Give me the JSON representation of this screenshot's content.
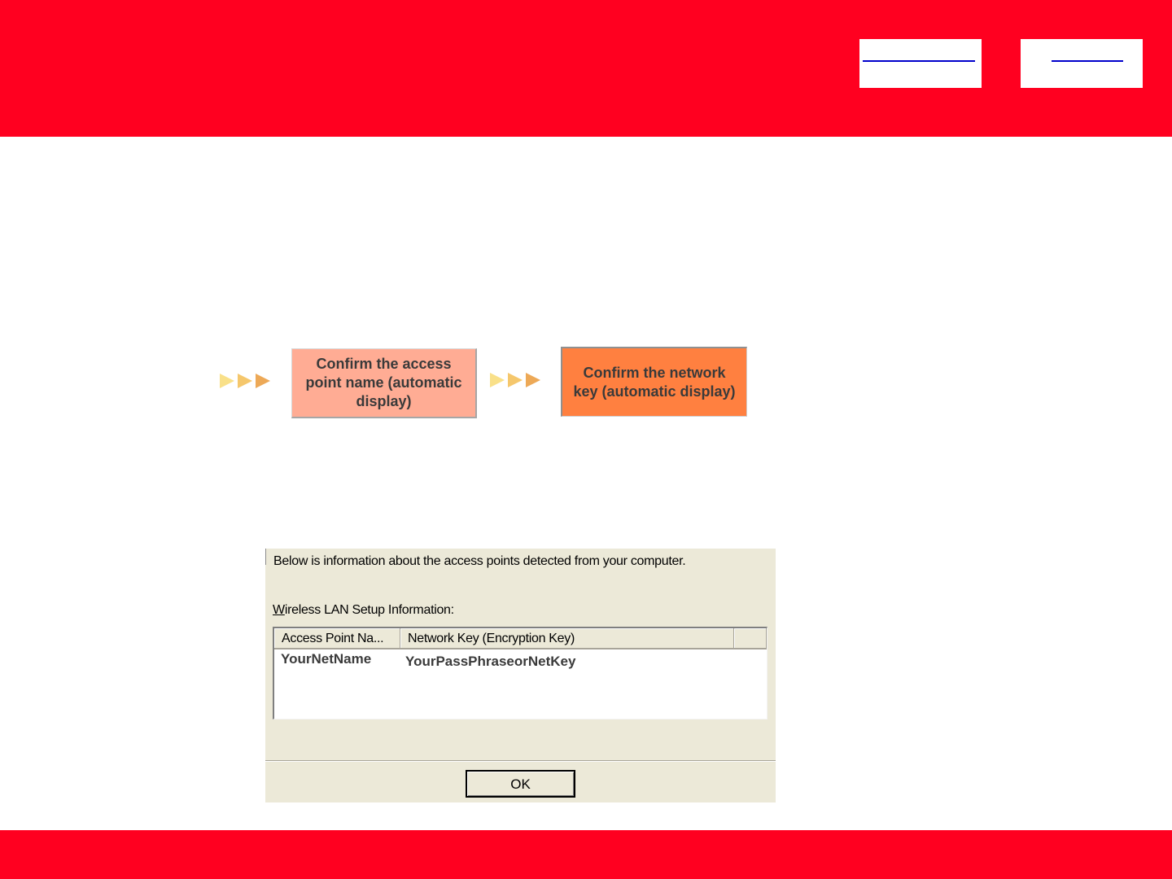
{
  "colors": {
    "brand_red": "#ff0020",
    "arrow_light": "#f9e089",
    "arrow_mid": "#f5c76c",
    "arrow_dark": "#eda957",
    "step_inactive": "#ffac94",
    "step_active": "#ff8040",
    "dialog_bg": "#ece9d8"
  },
  "header": {
    "nav_links": [
      "",
      ""
    ]
  },
  "flow": {
    "arrow_icon": "triple-chevron-right",
    "steps": [
      {
        "label": "Confirm the access point name (automatic display)",
        "state": "completed"
      },
      {
        "label": "Confirm the network key (automatic display)",
        "state": "current"
      }
    ]
  },
  "dialog": {
    "intro": "Below is information about the access points detected from your computer.",
    "list_label_mnemonic": "W",
    "list_label_rest": "ireless LAN Setup Information:",
    "columns": [
      "Access Point Na...",
      "Network Key (Encryption Key)",
      ""
    ],
    "rows": [
      {
        "access_point": "YourNetName",
        "network_key": "YourPassPhraseorNetKey"
      }
    ],
    "ok_label": "OK"
  }
}
